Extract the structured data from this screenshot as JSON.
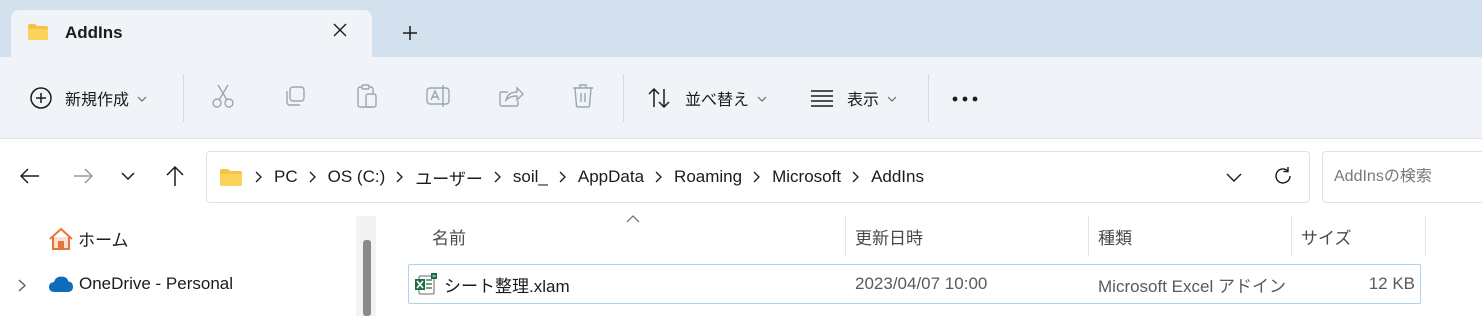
{
  "window": {
    "tab": {
      "title": "AddIns",
      "folder_icon": "folder-icon",
      "close_icon": "close-icon"
    },
    "new_tab_icon": "plus-icon"
  },
  "toolbar": {
    "new_label": "新規作成",
    "sort_label": "並べ替え",
    "view_label": "表示",
    "more_icon": "more-icon",
    "icons": [
      "cut-icon",
      "copy-icon",
      "paste-icon",
      "rename-icon",
      "share-icon",
      "delete-icon"
    ]
  },
  "navigation": {
    "back_icon": "back-arrow-icon",
    "forward_icon": "forward-arrow-icon",
    "recent_icon": "chevron-down-icon",
    "up_icon": "up-arrow-icon"
  },
  "address": {
    "breadcrumbs": [
      "PC",
      "OS (C:)",
      "ユーザー",
      "soil_",
      "AppData",
      "Roaming",
      "Microsoft",
      "AddIns"
    ]
  },
  "search": {
    "placeholder": "AddInsの検索"
  },
  "sidebar": {
    "items": [
      {
        "label": "ホーム",
        "icon": "home-icon"
      },
      {
        "label": "OneDrive - Personal",
        "icon": "cloud-icon"
      }
    ]
  },
  "file_list": {
    "columns": [
      "名前",
      "更新日時",
      "種類",
      "サイズ"
    ],
    "rows": [
      {
        "name": "シート整理.xlam",
        "modified": "2023/04/07 10:00",
        "type": "Microsoft Excel アドイン",
        "size": "12 KB",
        "icon": "excel-addin-icon"
      }
    ]
  },
  "colors": {
    "tabstrip_bg": "#d3e0ee",
    "toolbar_bg": "#f0f4f9",
    "folder_yellow": "#f5c242",
    "selection_border": "#b0d1f0",
    "onedrive_blue": "#0f6cbd",
    "excel_green": "#1d6f42"
  }
}
